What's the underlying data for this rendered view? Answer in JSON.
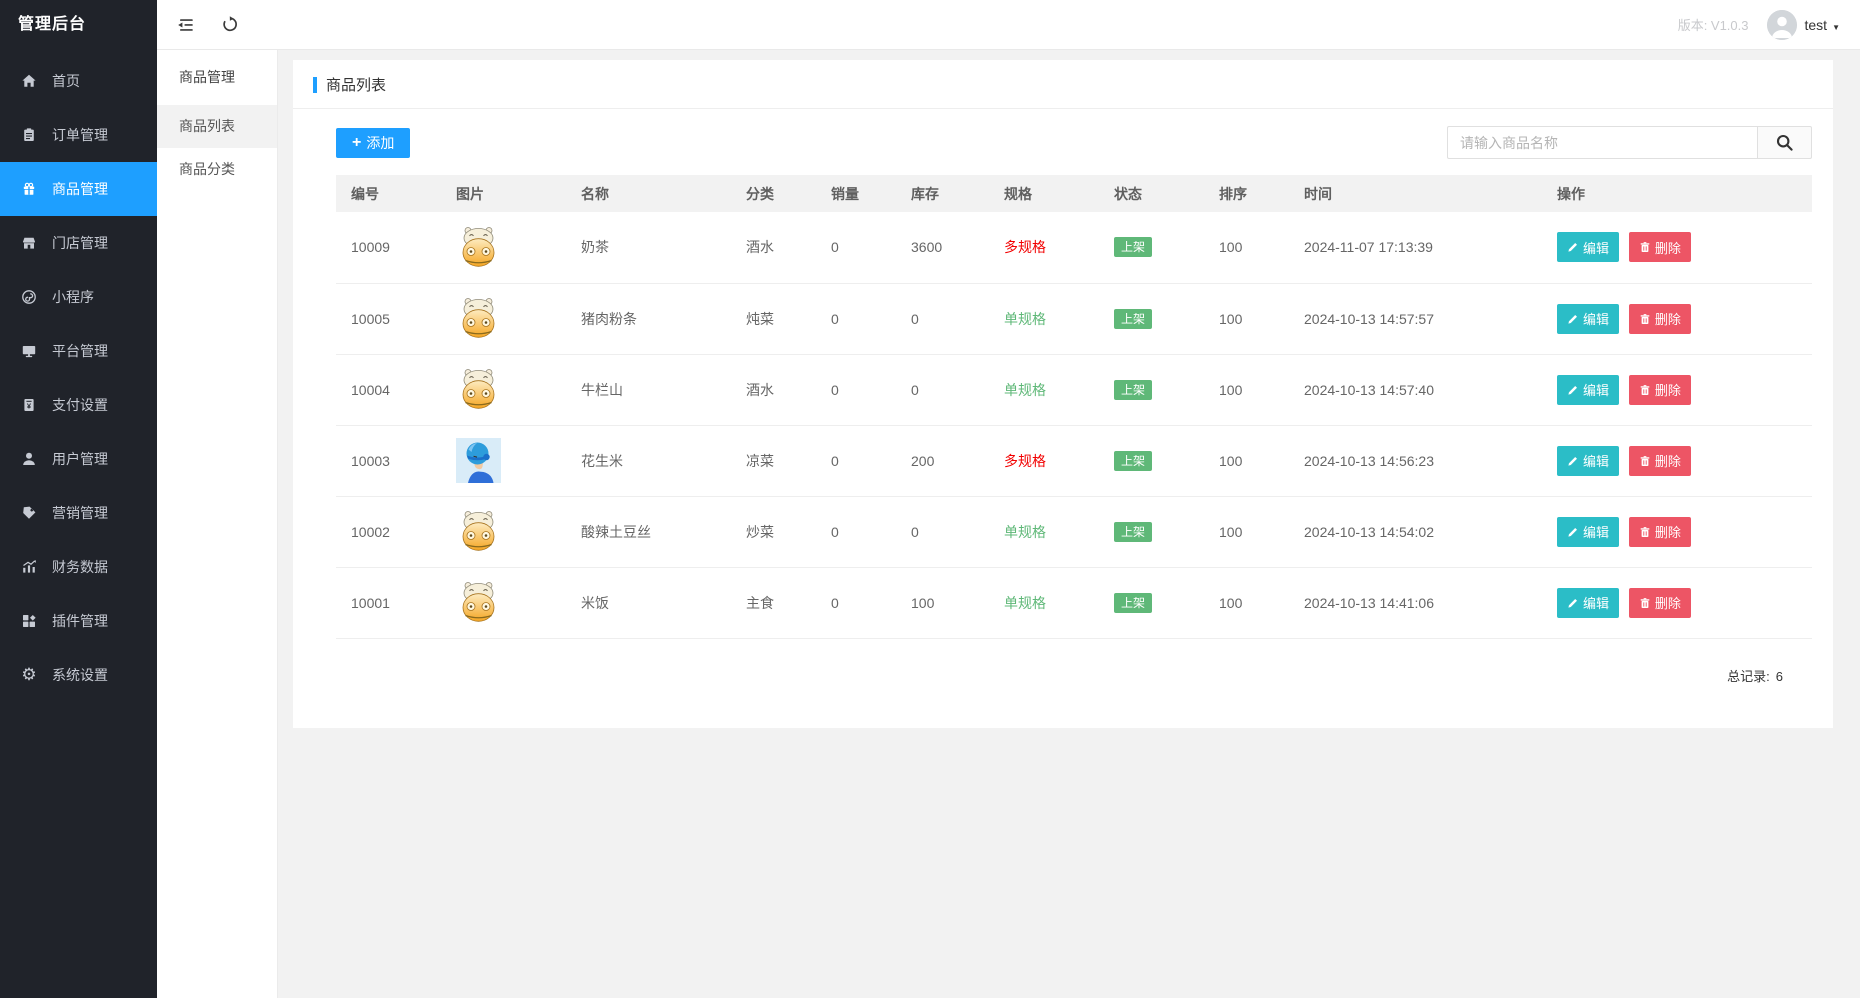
{
  "app": {
    "logo": "管理后台",
    "version": "版本: V1.0.3",
    "user": "test"
  },
  "colors": {
    "primary": "#1E9FFF",
    "green": "#5FB878",
    "red": "#F20000",
    "cyan": "#2BBDC7",
    "pink": "#ED5565",
    "sidebar": "#20232A"
  },
  "sidebar": {
    "items": [
      {
        "label": "首页",
        "icon": "home-icon",
        "active": false
      },
      {
        "label": "订单管理",
        "icon": "order-icon",
        "active": false
      },
      {
        "label": "商品管理",
        "icon": "goods-icon",
        "active": true
      },
      {
        "label": "门店管理",
        "icon": "store-icon",
        "active": false
      },
      {
        "label": "小程序",
        "icon": "miniprogram-icon",
        "active": false
      },
      {
        "label": "平台管理",
        "icon": "monitor-icon",
        "active": false
      },
      {
        "label": "支付设置",
        "icon": "payment-icon",
        "active": false
      },
      {
        "label": "用户管理",
        "icon": "user-icon",
        "active": false
      },
      {
        "label": "营销管理",
        "icon": "tag-icon",
        "active": false
      },
      {
        "label": "财务数据",
        "icon": "chart-icon",
        "active": false
      },
      {
        "label": "插件管理",
        "icon": "plugin-icon",
        "active": false
      },
      {
        "label": "系统设置",
        "icon": "gear-icon",
        "active": false
      }
    ]
  },
  "submenu": {
    "title": "商品管理",
    "items": [
      {
        "label": "商品列表",
        "active": true
      },
      {
        "label": "商品分类",
        "active": false
      }
    ]
  },
  "content": {
    "card_title": "商品列表",
    "add_label": "添加",
    "search_placeholder": "请输入商品名称",
    "table": {
      "columns": [
        "编号",
        "图片",
        "名称",
        "分类",
        "销量",
        "库存",
        "规格",
        "状态",
        "排序",
        "时间",
        "操作"
      ],
      "edit_label": "编辑",
      "delete_label": "删除",
      "rows": [
        {
          "id": "10009",
          "image": "hippo",
          "name": "奶茶",
          "category": "酒水",
          "sales": "0",
          "stock": "3600",
          "spec": "多规格",
          "spec_type": "multi",
          "status": "上架",
          "sort": "100",
          "time": "2024-11-07 17:13:39"
        },
        {
          "id": "10005",
          "image": "hippo",
          "name": "猪肉粉条",
          "category": "炖菜",
          "sales": "0",
          "stock": "0",
          "spec": "单规格",
          "spec_type": "single",
          "status": "上架",
          "sort": "100",
          "time": "2024-10-13 14:57:57"
        },
        {
          "id": "10004",
          "image": "hippo",
          "name": "牛栏山",
          "category": "酒水",
          "sales": "0",
          "stock": "0",
          "spec": "单规格",
          "spec_type": "single",
          "status": "上架",
          "sort": "100",
          "time": "2024-10-13 14:57:40"
        },
        {
          "id": "10003",
          "image": "rider",
          "name": "花生米",
          "category": "凉菜",
          "sales": "0",
          "stock": "200",
          "spec": "多规格",
          "spec_type": "multi",
          "status": "上架",
          "sort": "100",
          "time": "2024-10-13 14:56:23"
        },
        {
          "id": "10002",
          "image": "hippo",
          "name": "酸辣土豆丝",
          "category": "炒菜",
          "sales": "0",
          "stock": "0",
          "spec": "单规格",
          "spec_type": "single",
          "status": "上架",
          "sort": "100",
          "time": "2024-10-13 14:54:02"
        },
        {
          "id": "10001",
          "image": "hippo",
          "name": "米饭",
          "category": "主食",
          "sales": "0",
          "stock": "100",
          "spec": "单规格",
          "spec_type": "single",
          "status": "上架",
          "sort": "100",
          "time": "2024-10-13 14:41:06"
        }
      ]
    },
    "total_label": "总记录:",
    "total_value": "6"
  }
}
